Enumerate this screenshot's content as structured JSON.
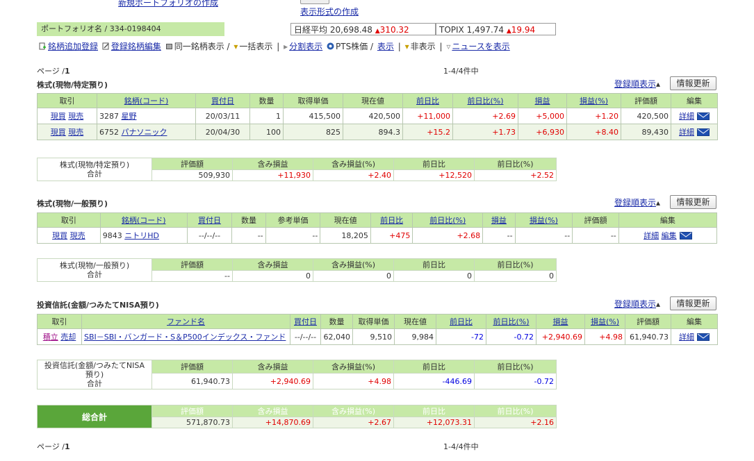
{
  "top": {
    "create_link": "新規ポートフォリオの作成",
    "format_link": "表示形式の作成"
  },
  "portfolio": {
    "name": "ポートフォリオ名 / 334-0198404"
  },
  "indices": {
    "nikkei_label": "日経平均",
    "nikkei_value": "20,698.48",
    "nikkei_change": "310.32",
    "topix_label": "TOPIX",
    "topix_value": "1,497.74",
    "topix_change": "19.94",
    "up_color": "#e00000"
  },
  "toolbar": {
    "add": "銘柄追加登録",
    "edit": "登録銘柄編集",
    "same": "同一銘柄表示 /",
    "bulk": "一括表示",
    "split": "分割表示",
    "pts": "PTS株価 /",
    "show": "表示",
    "hide": "非表示",
    "news": "ニュースを表示",
    "sep": "|"
  },
  "paging": {
    "page": "ページ /",
    "page_num": "1",
    "count": "1-4/4件中"
  },
  "buttons": {
    "order": "登録順表示",
    "refresh": "情報更新"
  },
  "common": {
    "detail": "詳細",
    "edit": "編集"
  },
  "sec1": {
    "title": "株式(現物/特定預り)",
    "headers": [
      "取引",
      "銘柄(コード)",
      "買付日",
      "数量",
      "取得単価",
      "現在値",
      "前日比",
      "前日比(%)",
      "損益",
      "損益(%)",
      "評価額",
      "編集"
    ],
    "rows": [
      {
        "buy": "現買",
        "sell": "現売",
        "code": "3287",
        "name": "星野",
        "date": "20/03/11",
        "qty": "1",
        "cost": "415,500",
        "price": "420,500",
        "chg": "+11,000",
        "chgp": "+2.69",
        "pl": "+5,000",
        "plp": "+1.20",
        "value": "420,500"
      },
      {
        "buy": "現買",
        "sell": "現売",
        "code": "6752",
        "name": "パナソニック",
        "date": "20/04/30",
        "qty": "100",
        "cost": "825",
        "price": "894.3",
        "chg": "+15.2",
        "chgp": "+1.73",
        "pl": "+6,930",
        "plp": "+8.40",
        "value": "89,430"
      }
    ],
    "sum_label1": "株式(現物/特定預り)",
    "sum_label2": "合計",
    "sum_headers": [
      "評価額",
      "含み損益",
      "含み損益(%)",
      "前日比",
      "前日比(%)"
    ],
    "sum_values": [
      "509,930",
      "+11,930",
      "+2.40",
      "+12,520",
      "+2.52"
    ]
  },
  "sec2": {
    "title": "株式(現物/一般預り)",
    "headers": [
      "取引",
      "銘柄(コード)",
      "買付日",
      "数量",
      "参考単価",
      "現在値",
      "前日比",
      "前日比(%)",
      "損益",
      "損益(%)",
      "評価額",
      "編集"
    ],
    "row": {
      "buy": "現買",
      "sell": "現売",
      "code": "9843",
      "name": "ニトリHD",
      "date": "--/--/--",
      "qty": "--",
      "cost": "--",
      "price": "18,205",
      "chg": "+475",
      "chgp": "+2.68",
      "pl": "--",
      "plp": "--",
      "value": "--"
    },
    "sum_label1": "株式(現物/一般預り)",
    "sum_label2": "合計",
    "sum_headers": [
      "評価額",
      "含み損益",
      "含み損益(%)",
      "前日比",
      "前日比(%)"
    ],
    "sum_values": [
      "--",
      "0",
      "0",
      "0",
      "0"
    ]
  },
  "sec3": {
    "title": "投資信託(金額/つみたてNISA預り)",
    "headers": [
      "取引",
      "ファンド名",
      "買付日",
      "数量",
      "取得単価",
      "現在値",
      "前日比",
      "前日比(%)",
      "損益",
      "損益(%)",
      "評価額",
      "編集"
    ],
    "row": {
      "buy": "積立",
      "sell": "売却",
      "name": "SBI－SBI・バンガード・S＆P500インデックス・ファンド",
      "date": "--/--/--",
      "qty": "62,040",
      "cost": "9,510",
      "price": "9,984",
      "chg": "-72",
      "chgp": "-0.72",
      "pl": "+2,940.69",
      "plp": "+4.98",
      "value": "61,940.73"
    },
    "sum_label1": "投資信託(金額/つみたてNISA",
    "sum_label1b": "預り)",
    "sum_label2": "合計",
    "sum_headers": [
      "評価額",
      "含み損益",
      "含み損益(%)",
      "前日比",
      "前日比(%)"
    ],
    "sum_values": [
      "61,940.73",
      "+2,940.69",
      "+4.98",
      "-446.69",
      "-0.72"
    ]
  },
  "grand": {
    "label": "総合計",
    "headers": [
      "評価額",
      "含み損益",
      "含み損益(%)",
      "前日比",
      "前日比(%)"
    ],
    "values": [
      "571,870.73",
      "+14,870.69",
      "+2.67",
      "+12,073.31",
      "+2.16"
    ]
  }
}
